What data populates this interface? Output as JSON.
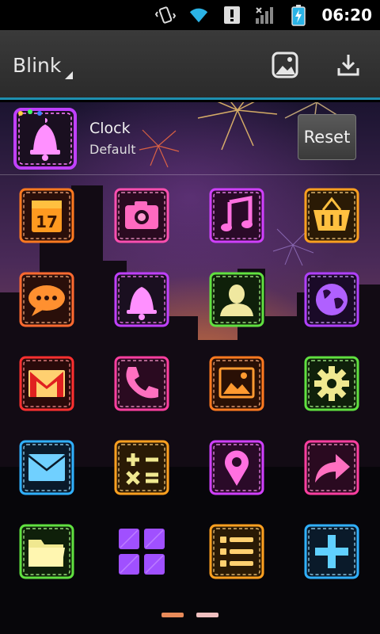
{
  "status_bar": {
    "time": "06:20",
    "icons": [
      "vibrate-icon",
      "wifi-icon",
      "alert-icon",
      "signal-icon",
      "battery-charging-icon"
    ]
  },
  "action_bar": {
    "title": "Blink",
    "actions": [
      "wallpaper-icon",
      "download-icon"
    ]
  },
  "selected": {
    "icon": "bell-icon",
    "name": "Clock",
    "theme": "Default",
    "reset_label": "Reset"
  },
  "grid": {
    "icons": [
      "calendar-icon",
      "camera-icon",
      "music-icon",
      "shopping-basket-icon",
      "message-icon",
      "bell-icon",
      "contact-icon",
      "globe-icon",
      "gmail-icon",
      "phone-icon",
      "gallery-icon",
      "settings-gear-icon",
      "email-icon",
      "calculator-icon",
      "map-pin-icon",
      "share-arrow-icon",
      "folder-icon",
      "app-drawer-icon",
      "task-list-icon",
      "add-icon"
    ],
    "calendar_day": "17"
  },
  "pager": {
    "pages": 2,
    "current": 1
  },
  "colors": {
    "accent": "#1e8fb0"
  }
}
